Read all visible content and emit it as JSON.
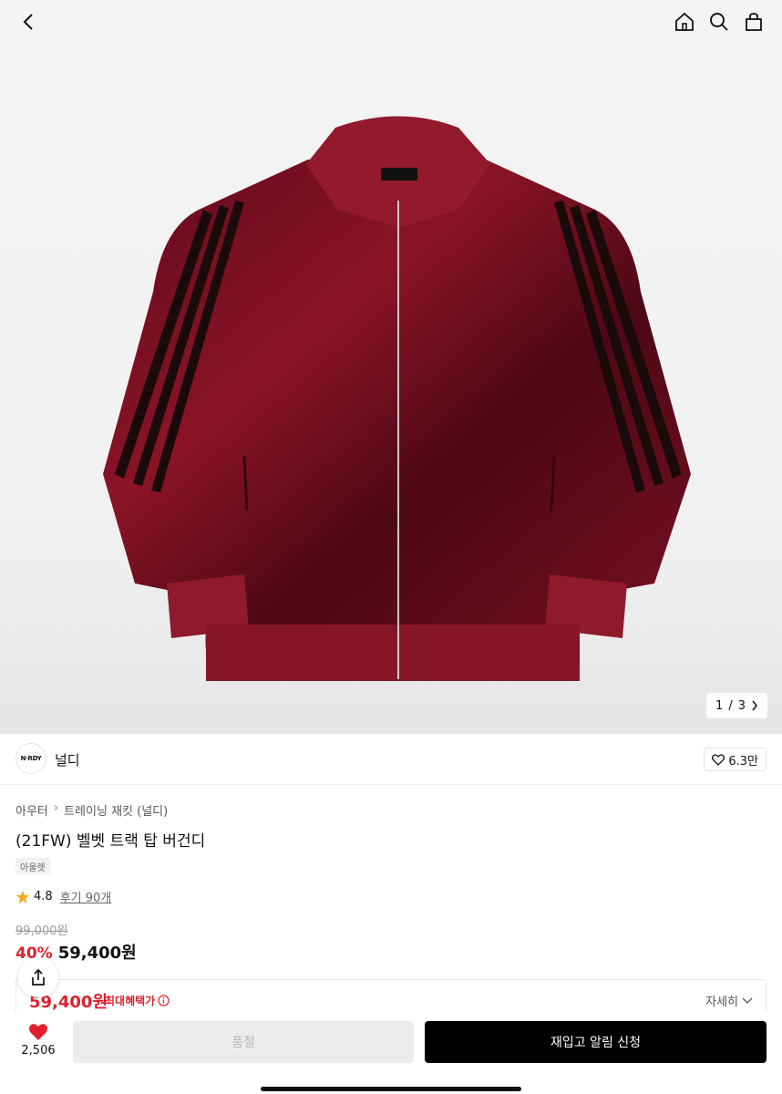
{
  "gallery": {
    "current": "1",
    "total": "3",
    "counter_sep": "/"
  },
  "brand": {
    "name": "널디",
    "logo_text": "N·RDY",
    "likes": "6.3만"
  },
  "breadcrumb": {
    "category": "아우터",
    "subcategory": "트레이닝 재킷 (널디)"
  },
  "product": {
    "title": "(21FW) 벨벳 트랙 탑 버건디",
    "tag": "아울렛",
    "rating": "4.8",
    "reviews": "후기 90개",
    "original_price": "99,000원",
    "discount": "40%",
    "sale_price": "59,400원"
  },
  "benefit": {
    "price": "59,400원",
    "label": "최대혜택가",
    "detail_label": "자세히"
  },
  "bottom": {
    "wish_count": "2,506",
    "soldout_label": "품절",
    "restock_label": "재입고 알림 신청"
  },
  "colors": {
    "accent": "#e0202b",
    "primary_btn": "#000000",
    "jacket": "#7a0f22"
  },
  "icons": [
    "back-icon",
    "home-icon",
    "search-icon",
    "bag-icon",
    "heart-icon",
    "share-icon",
    "star-icon",
    "info-icon",
    "chevron-down-icon",
    "chevron-right-icon"
  ]
}
